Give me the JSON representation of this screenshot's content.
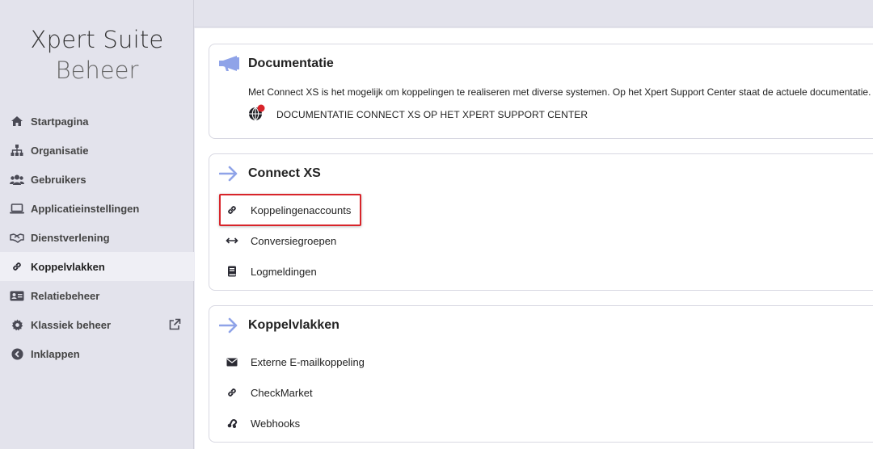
{
  "brand": {
    "line1": "Xpert Suite",
    "line2": "Beheer"
  },
  "sidebar": {
    "items": [
      {
        "label": "Startpagina",
        "icon": "home-icon"
      },
      {
        "label": "Organisatie",
        "icon": "sitemap-icon"
      },
      {
        "label": "Gebruikers",
        "icon": "users-icon"
      },
      {
        "label": "Applicatieinstellingen",
        "icon": "laptop-icon"
      },
      {
        "label": "Dienstverlening",
        "icon": "handshake-icon"
      },
      {
        "label": "Koppelvlakken",
        "icon": "link-icon",
        "active": true
      },
      {
        "label": "Relatiebeheer",
        "icon": "id-card-icon"
      },
      {
        "label": "Klassiek beheer",
        "icon": "gear-icon",
        "external": true
      },
      {
        "label": "Inklappen",
        "icon": "chevron-left-circle-icon"
      }
    ]
  },
  "cards": {
    "documentatie": {
      "title": "Documentatie",
      "icon": "megaphone-icon",
      "text": "Met Connect XS is het mogelijk om koppelingen te realiseren met diverse systemen. Op het Xpert Support Center staat de actuele documentatie.",
      "link_label": "DOCUMENTATIE CONNECT XS OP HET XPERT SUPPORT CENTER",
      "link_icon": "globe-icon"
    },
    "connect": {
      "title": "Connect XS",
      "icon": "arrow-right-icon",
      "items": [
        {
          "label": "Koppelingenaccounts",
          "icon": "link-icon",
          "highlighted": true
        },
        {
          "label": "Conversiegroepen",
          "icon": "arrows-horizontal-icon"
        },
        {
          "label": "Logmeldingen",
          "icon": "book-icon"
        }
      ]
    },
    "koppelvlakken": {
      "title": "Koppelvlakken",
      "icon": "arrow-right-icon",
      "items": [
        {
          "label": "Externe E-mailkoppeling",
          "icon": "envelope-icon"
        },
        {
          "label": "CheckMarket",
          "icon": "link-icon"
        },
        {
          "label": "Webhooks",
          "icon": "webhook-icon"
        }
      ]
    }
  },
  "colors": {
    "accent_arrow": "#8fa3e8",
    "highlight": "#d8242a",
    "sidebar_bg": "#e3e3ec"
  }
}
